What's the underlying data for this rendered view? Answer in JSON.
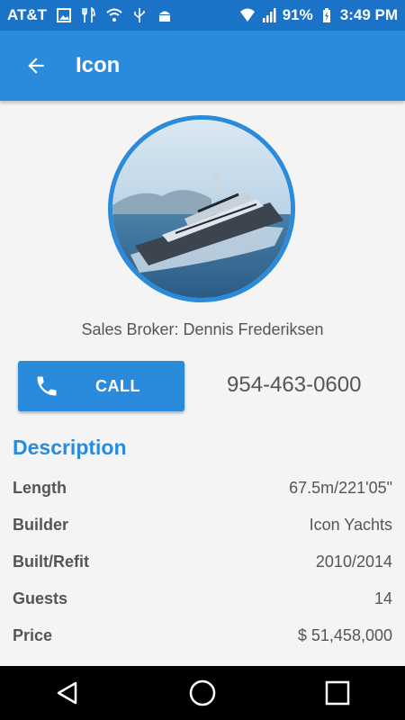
{
  "status_bar": {
    "carrier": "AT&T",
    "battery": "91%",
    "time": "3:49 PM",
    "icons": [
      "image-icon",
      "restaurant-icon",
      "wifi-icon",
      "usb-icon",
      "android-icon",
      "wifi-icon",
      "signal-icon",
      "battery-icon"
    ]
  },
  "app_bar": {
    "title": "Icon",
    "back_icon": "arrow-back-icon"
  },
  "profile": {
    "broker": "Sales Broker: Dennis Frederiksen",
    "call_label": "CALL",
    "phone": "954-463-0600"
  },
  "description": {
    "title": "Description",
    "rows": [
      {
        "key": "Length",
        "value": "67.5m/221'05\""
      },
      {
        "key": "Builder",
        "value": "Icon Yachts"
      },
      {
        "key": "Built/Refit",
        "value": "2010/2014"
      },
      {
        "key": "Guests",
        "value": "14"
      },
      {
        "key": "Price",
        "value": "$ 51,458,000"
      }
    ]
  },
  "colors": {
    "primary": "#2a8bdc",
    "status_bar": "#1a73c7",
    "background": "#f4f4f4"
  }
}
